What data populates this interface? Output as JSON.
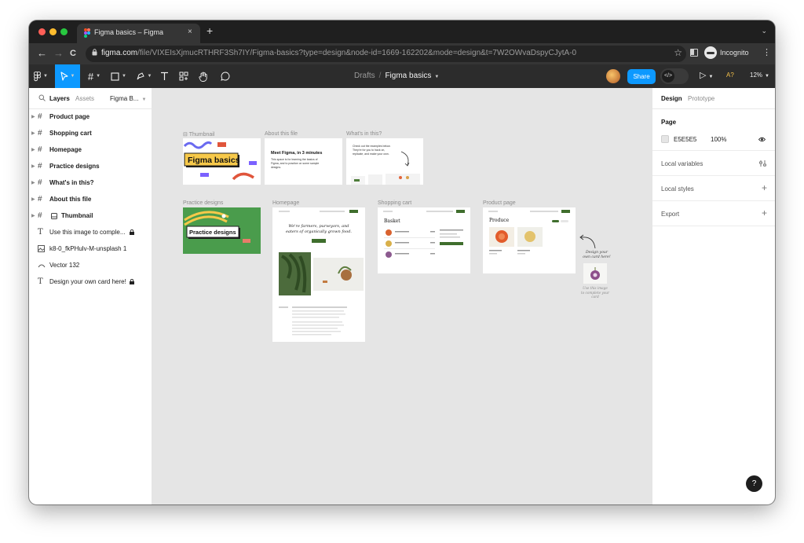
{
  "browser": {
    "tab_title": "Figma basics – Figma",
    "tab_close": "×",
    "new_tab": "+",
    "tab_menu": "⌄",
    "url_host": "figma.com",
    "url_path": "/file/VIXEIsXjmucRTHRF3Sh7IY/Figma-basics?type=design&node-id=1669-162202&mode=design&t=7W2OWvaDspyCJytA-0",
    "incognito_label": "Incognito",
    "nav": {
      "back": "←",
      "forward": "→",
      "reload": "C"
    },
    "star": "☆",
    "kebab": "⋮"
  },
  "toolbar": {
    "breadcrumb_parent": "Drafts",
    "breadcrumb_sep": "/",
    "file_name": "Figma basics",
    "share_label": "Share",
    "dev_mode_label": "</>",
    "play_label": "▷",
    "a11y_label": "A?",
    "zoom": "12%"
  },
  "left_panel": {
    "tab_layers": "Layers",
    "tab_assets": "Assets",
    "page_name": "Figma B...",
    "layers": [
      {
        "label": "Product page",
        "icon": "frame-icon",
        "bold": true,
        "locked": false
      },
      {
        "label": "Shopping cart",
        "icon": "frame-icon",
        "bold": true,
        "locked": false
      },
      {
        "label": "Homepage",
        "icon": "frame-icon",
        "bold": true,
        "locked": false
      },
      {
        "label": "Practice designs",
        "icon": "frame-icon",
        "bold": true,
        "locked": false
      },
      {
        "label": "What's in this?",
        "icon": "frame-icon",
        "bold": true,
        "locked": false
      },
      {
        "label": "About this file",
        "icon": "frame-icon",
        "bold": true,
        "locked": false
      },
      {
        "label": "Thumbnail",
        "icon": "frame-icon",
        "bold": true,
        "locked": false
      },
      {
        "label": "Use this image to comple...",
        "icon": "text-icon",
        "bold": false,
        "locked": true
      },
      {
        "label": "k8-0_fkPHulv-M-unsplash 1",
        "icon": "image-icon",
        "bold": false,
        "locked": false
      },
      {
        "label": "Vector 132",
        "icon": "vector-icon",
        "bold": false,
        "locked": false
      },
      {
        "label": "Design your own card here!",
        "icon": "text-icon",
        "bold": false,
        "locked": true
      }
    ]
  },
  "canvas": {
    "background": "#E5E5E5",
    "frames": {
      "thumbnail": {
        "label": "Thumbnail",
        "text": "Figma basics"
      },
      "about": {
        "label": "About this file",
        "heading": "Meet Figma, in 3 minutes",
        "body": "This space is for learning the basics of Figma, and to practice on some sample designs."
      },
      "whats_in": {
        "label": "What's in this?",
        "body": "Check out the examples below. They're for you to hack on, replicate, and make your own."
      },
      "practice": {
        "label": "Practice designs",
        "text": "Practice designs"
      },
      "homepage": {
        "label": "Homepage",
        "headline": "We're farmers, purveyors, and eaters of organically grown food."
      },
      "cart": {
        "label": "Shopping cart",
        "heading": "Basket"
      },
      "product": {
        "label": "Product page",
        "heading": "Produce"
      }
    },
    "annotation_top": "Design your own card here!",
    "annotation_bottom": "Use this image to complete your card"
  },
  "right_panel": {
    "tab_design": "Design",
    "tab_prototype": "Prototype",
    "page_heading": "Page",
    "page_color": "E5E5E5",
    "page_opacity": "100%",
    "local_variables": "Local variables",
    "local_styles": "Local styles",
    "export": "Export",
    "plus": "+"
  },
  "help_label": "?"
}
